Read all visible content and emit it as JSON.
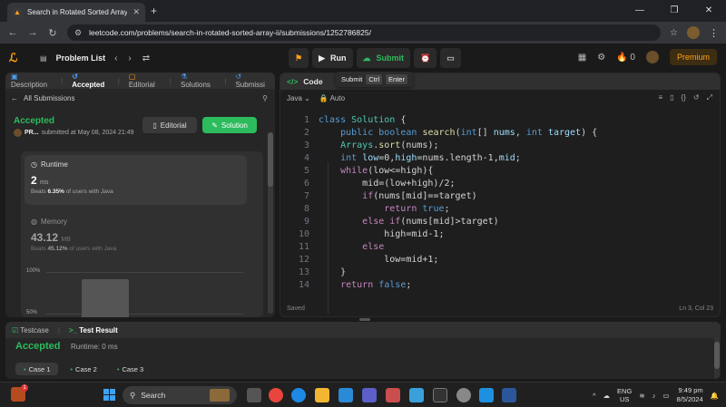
{
  "browser": {
    "tab_title": "Search in Rotated Sorted Array",
    "new_tab": "+",
    "url": "leetcode.com/problems/search-in-rotated-sorted-array-ii/submissions/1252786825/"
  },
  "nav": {
    "problem_list": "Problem List",
    "run": "Run",
    "submit": "Submit",
    "streak": "0",
    "premium": "Premium"
  },
  "tooltip": {
    "label": "Submit",
    "key1": "Ctrl",
    "key2": "Enter"
  },
  "left": {
    "tabs": [
      "Description",
      "Accepted",
      "Editorial",
      "Solutions",
      "Submissi"
    ],
    "all_submissions": "All Submissions",
    "status": "Accepted",
    "user": "PR...",
    "submitted": "submitted at May 08, 2024 21:49",
    "editorial_btn": "Editorial",
    "solution_btn": "Solution",
    "runtime_label": "Runtime",
    "runtime_value": "2",
    "runtime_unit": "ms",
    "runtime_beats_pre": "Beats",
    "runtime_beats": "6.35%",
    "runtime_beats_post": "of users with Java",
    "memory_label": "Memory",
    "memory_value": "43.12",
    "memory_unit": "MB",
    "memory_beats_pre": "Beats",
    "memory_beats": "45.12%",
    "memory_beats_post": "of users with Java",
    "chart_ticks": [
      "100%",
      "50%"
    ]
  },
  "editor": {
    "title": "Code",
    "language": "Java",
    "mode": "Auto",
    "saved": "Saved",
    "cursor": "Ln 3, Col 23",
    "lines": [
      {
        "n": "1",
        "html": "<span class='kw'>class</span> <span class='ty'>Solution</span> {"
      },
      {
        "n": "2",
        "html": "    <span class='kw'>public</span> <span class='kw'>boolean</span> <span class='fn'>search</span>(<span class='kw'>int</span>[] <span class='pr'>nums</span>, <span class='kw'>int</span> <span class='pr'>target</span>) {"
      },
      {
        "n": "3",
        "html": "    <span class='ty'>Arrays</span>.<span class='fn'>sort</span>(nums);"
      },
      {
        "n": "4",
        "html": "    <span class='kw'>int</span> <span class='pr'>low</span>=0,<span class='pr'>high</span>=nums.length-1,<span class='pr'>mid</span>;"
      },
      {
        "n": "5",
        "html": "    <span class='ct'>while</span>(low&lt;=high){"
      },
      {
        "n": "6",
        "html": "        mid=(low+high)/2;"
      },
      {
        "n": "7",
        "html": "        <span class='ct'>if</span>(nums[mid]==target)"
      },
      {
        "n": "8",
        "html": "            <span class='ct'>return</span> <span class='kw'>true</span>;"
      },
      {
        "n": "9",
        "html": "        <span class='ct'>else if</span>(nums[mid]&gt;target)"
      },
      {
        "n": "10",
        "html": "            high=mid-1;"
      },
      {
        "n": "11",
        "html": "        <span class='ct'>else</span>"
      },
      {
        "n": "12",
        "html": "            low=mid+1;"
      },
      {
        "n": "13",
        "html": "    }"
      },
      {
        "n": "14",
        "html": "    <span class='ct'>return</span> <span class='kw'>false</span>;"
      }
    ]
  },
  "bottom": {
    "tab_testcase": "Testcase",
    "tab_result": "Test Result",
    "status": "Accepted",
    "runtime": "Runtime: 0 ms",
    "cases": [
      "Case 1",
      "Case 2",
      "Case 3"
    ]
  },
  "taskbar": {
    "search": "Search",
    "lang1": "ENG",
    "lang2": "US",
    "time": "9:49 pm",
    "date": "8/5/2024"
  },
  "colors": {
    "accent": "#ffa116",
    "success": "#2cbb5d"
  }
}
